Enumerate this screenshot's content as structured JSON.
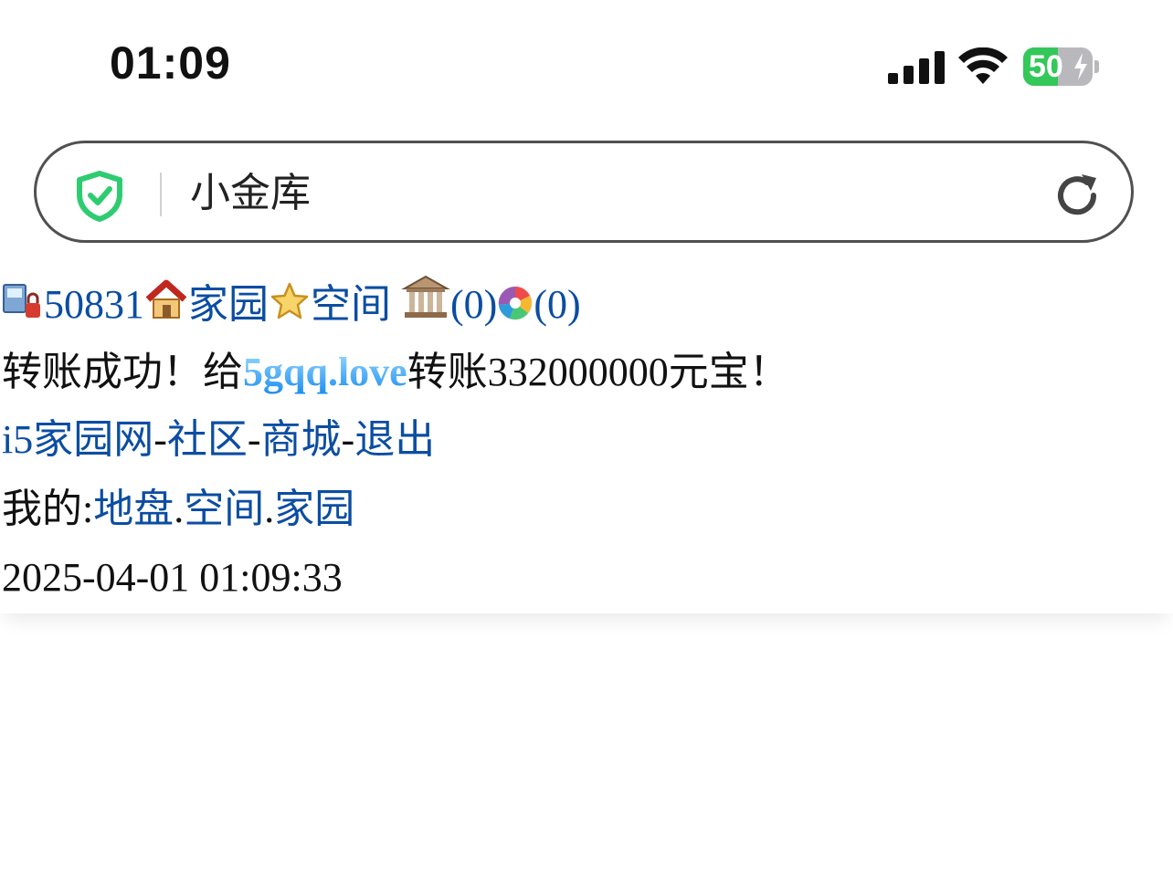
{
  "status_bar": {
    "time": "01:09",
    "battery_percent": "50",
    "battery_level": 0.5,
    "icons": [
      "signal-icon",
      "wifi-icon",
      "battery-icon",
      "charging-bolt-icon"
    ]
  },
  "address_bar": {
    "title": "小金库",
    "icons": [
      "shield-check-icon",
      "reload-icon"
    ],
    "accent": "#2ecc71"
  },
  "nav": {
    "user_id": "50831",
    "home_link": "家园",
    "space_link": "空间",
    "bank_count": "(0)",
    "photo_count": "(0)",
    "icons": [
      "user-lock-icon",
      "house-icon",
      "star-icon",
      "bank-building-icon",
      "photo-aperture-icon"
    ]
  },
  "message": {
    "prefix": "转账成功！给",
    "recipient": "5gqq.love",
    "suffix": "转账332000000元宝！"
  },
  "site_links": {
    "home": "i5家园网",
    "sep1": "-",
    "community": "社区",
    "sep2": "-",
    "mall": "商城",
    "sep3": "-",
    "logout": "退出"
  },
  "mine": {
    "label": "我的:",
    "land": "地盘",
    "dot1": ".",
    "space": "空间",
    "dot2": ".",
    "home": "家园"
  },
  "timestamp": "2025-04-01 01:09:33",
  "colors": {
    "link": "#0b4da2",
    "battery_green": "#34c759",
    "recipient_gradient_top": "#9fdcff",
    "recipient_gradient_bottom": "#1b8ef0"
  }
}
